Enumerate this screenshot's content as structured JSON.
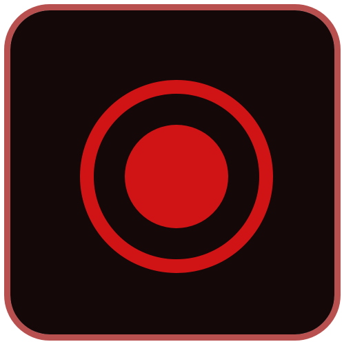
{
  "app_icon": {
    "icon": "record-icon",
    "colors": {
      "background": "#140809",
      "border": "#b85050",
      "record_ring": "#d01416",
      "record_dot": "#d01416"
    }
  }
}
